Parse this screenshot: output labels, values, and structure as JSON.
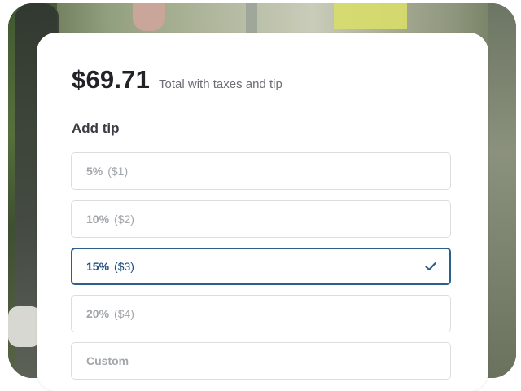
{
  "summary": {
    "total_amount": "$69.71",
    "total_caption": "Total with taxes and tip"
  },
  "tip_section": {
    "heading": "Add tip",
    "options": [
      {
        "percent": "5%",
        "amount": "($1)",
        "selected": false
      },
      {
        "percent": "10%",
        "amount": "($2)",
        "selected": false
      },
      {
        "percent": "15%",
        "amount": "($3)",
        "selected": true
      },
      {
        "percent": "20%",
        "amount": "($4)",
        "selected": false
      },
      {
        "percent": "Custom",
        "amount": "",
        "selected": false
      }
    ],
    "selected_icon": "checkmark-icon"
  },
  "colors": {
    "accent": "#2c5f8d",
    "text_primary": "#222327",
    "text_muted": "#a3a6ab"
  }
}
